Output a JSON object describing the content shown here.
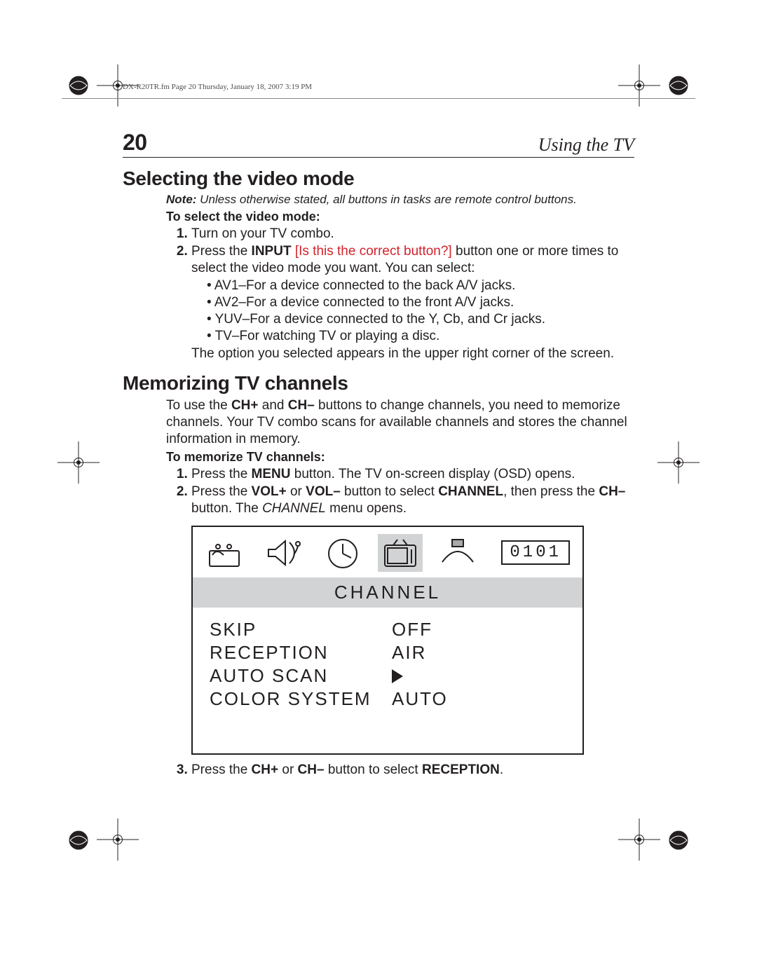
{
  "footer_meta": "DX-R20TR.fm  Page 20  Thursday, January 18, 2007  3:19 PM",
  "page_number": "20",
  "running_head": "Using the TV",
  "section1": {
    "title": "Selecting the video mode",
    "note_prefix": "Note:",
    "note_body": " Unless otherwise stated, all buttons in tasks are remote control buttons.",
    "sub": "To select the video mode:",
    "step1": "Turn on your TV combo.",
    "step2_a": "Press the ",
    "step2_b": "INPUT",
    "step2_red": " [Is this the correct button?] ",
    "step2_c": "button one or more times to select the video mode you want. You can select:",
    "bullets": {
      "b0": "AV1–For a device connected to the back A/V jacks.",
      "b1": "AV2–For a device connected to the front A/V jacks.",
      "b2": "YUV–For a device connected to the Y, Cb, and Cr jacks.",
      "b3": "TV–For watching TV or playing a disc."
    },
    "tail": "The option you selected appears in the upper right corner of the screen."
  },
  "section2": {
    "title": "Memorizing TV channels",
    "intro_a": "To use the ",
    "intro_b": "CH+",
    "intro_c": " and ",
    "intro_d": "CH–",
    "intro_e": " buttons to change channels, you need to memorize channels. Your TV combo scans for available channels and stores the channel information in memory.",
    "sub": "To memorize TV channels:",
    "s1_a": "Press the ",
    "s1_b": "MENU",
    "s1_c": " button. The TV on-screen display (OSD) opens.",
    "s2_a": "Press the ",
    "s2_b": "VOL+",
    "s2_c": " or ",
    "s2_d": "VOL–",
    "s2_e": " button to select ",
    "s2_f": "CHANNEL",
    "s2_g": ", then press the ",
    "s2_h": "CH–",
    "s2_i": " button. The ",
    "s2_j": "CHANNEL",
    "s2_k": " menu opens.",
    "s3_a": "Press the ",
    "s3_b": "CH+",
    "s3_c": " or ",
    "s3_d": "CH–",
    "s3_e": " button to select ",
    "s3_f": "RECEPTION",
    "s3_g": "."
  },
  "osd": {
    "number": "0101",
    "title": "CHANNEL",
    "rows": {
      "r0k": "SKIP",
      "r0v": "OFF",
      "r1k": "RECEPTION",
      "r1v": "AIR",
      "r2k": "AUTO SCAN",
      "r3k": "COLOR SYSTEM",
      "r3v": "AUTO"
    },
    "icons": {
      "i0": "picture-icon",
      "i1": "sound-icon",
      "i2": "timer-icon",
      "i3": "channel-tv-icon",
      "i4": "function-icon"
    }
  }
}
